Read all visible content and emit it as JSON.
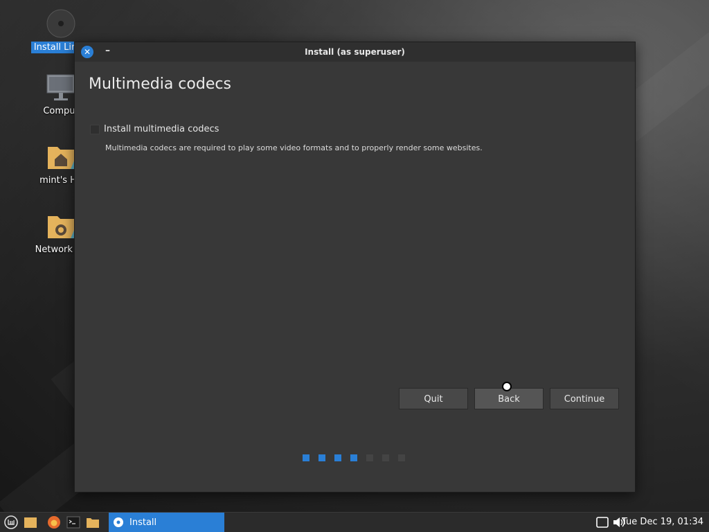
{
  "desktop": {
    "icons": [
      {
        "label": "Install Linux"
      },
      {
        "label": "Comput"
      },
      {
        "label": "mint's Ho"
      },
      {
        "label": "Network Se"
      }
    ]
  },
  "window": {
    "title": "Install (as superuser)",
    "close_glyph": "✕",
    "minimize_glyph": "–",
    "heading": "Multimedia codecs",
    "option_label": "Install multimedia codecs",
    "option_checked": false,
    "option_description": "Multimedia codecs are required to play some video formats and to properly render some websites.",
    "buttons": {
      "quit": "Quit",
      "back": "Back",
      "continue": "Continue"
    },
    "progress": {
      "completed_steps": 4,
      "total_steps": 7
    }
  },
  "taskbar": {
    "task_label": "Install",
    "clock": "Tue Dec 19, 01:34"
  },
  "colors": {
    "accent": "#2a7fd6",
    "window_bg": "#383838",
    "titlebar_bg": "#2f2f2f"
  }
}
